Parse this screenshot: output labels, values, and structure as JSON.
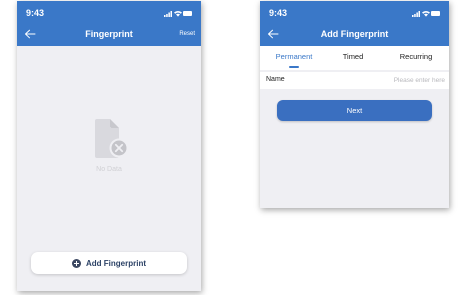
{
  "left_screen": {
    "status_time": "9:43",
    "title": "Fingerprint",
    "reset_label": "Reset",
    "empty_text": "No Data",
    "add_button_label": "Add Fingerprint",
    "icons": [
      "signal-icon",
      "wifi-icon",
      "battery-icon",
      "back-icon",
      "empty-document-icon",
      "plus-circle-icon"
    ]
  },
  "right_screen": {
    "status_time": "9:43",
    "title": "Add Fingerprint",
    "tabs": [
      {
        "label": "Permanent",
        "active": true
      },
      {
        "label": "Timed",
        "active": false
      },
      {
        "label": "Recurring",
        "active": false
      }
    ],
    "name_label": "Name",
    "name_placeholder": "Please enter here",
    "name_value": "",
    "next_label": "Next",
    "icons": [
      "signal-icon",
      "wifi-icon",
      "battery-icon",
      "back-icon"
    ]
  },
  "colors": {
    "header_blue": "#3a78c8",
    "button_blue": "#3a6fc0",
    "background": "#efeff3",
    "placeholder_gray": "#b8b8bd"
  }
}
